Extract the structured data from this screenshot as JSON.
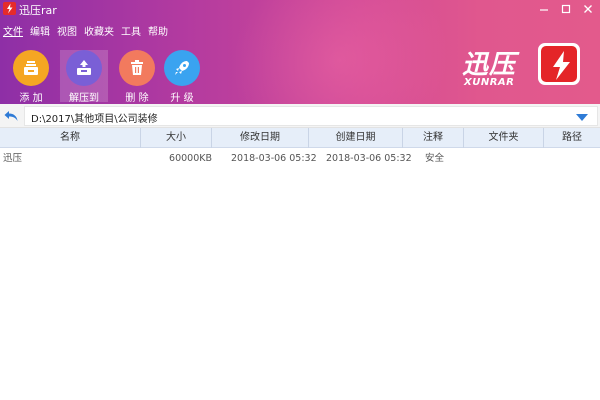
{
  "window": {
    "title": "迅压rar",
    "controls": {
      "minimize": "—",
      "maximize": "□",
      "close": "✕"
    }
  },
  "menu": [
    "文件",
    "编辑",
    "视图",
    "收藏夹",
    "工具",
    "帮助"
  ],
  "toolbar": [
    {
      "label": "添 加",
      "icon": "archive-add-icon",
      "color": "#f5a623"
    },
    {
      "label": "解压到",
      "icon": "extract-icon",
      "color": "#7a5fd6",
      "selected": true
    },
    {
      "label": "删 除",
      "icon": "trash-icon",
      "color": "#f27a5e"
    },
    {
      "label": "升 级",
      "icon": "rocket-icon",
      "color": "#3aa3f0"
    }
  ],
  "brand": {
    "name_cn": "迅压",
    "name_en": "XUNRAR",
    "accent": "#e42528"
  },
  "path": {
    "value": "D:\\2017\\其他项目\\公司装修"
  },
  "columns": [
    "名称",
    "大小",
    "修改日期",
    "创建日期",
    "注释",
    "文件夹",
    "路径"
  ],
  "rows": [
    {
      "name": "迅压",
      "size": "60000KB",
      "modified": "2018-03-06 05:32",
      "created": "2018-03-06 05:32",
      "note": "安全",
      "folder": "",
      "path": ""
    }
  ],
  "colors": {
    "header_gradient_start": "#8e2fa6",
    "header_gradient_end": "#e35a8c",
    "column_header_bg": "#e6eef9",
    "back_arrow": "#2f7bd6"
  }
}
